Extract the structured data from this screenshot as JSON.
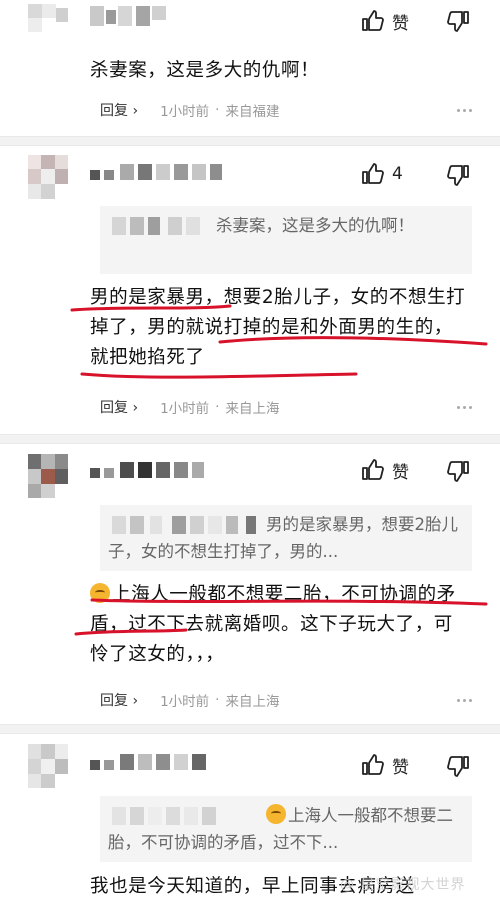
{
  "like_label": "赞",
  "reply_label": "回复",
  "comments": [
    {
      "likes": "赞",
      "text": "杀妻案，这是多大的仇啊！",
      "time": "1小时前",
      "location": "来自福建"
    },
    {
      "likes": "4",
      "quote_text": "杀妻案，这是多大的仇啊！",
      "text": "男的是家暴男，想要2胎儿子，女的不想生打掉了，男的就说打掉的是和外面男的生的，就把她掐死了",
      "time": "1小时前",
      "location": "来自上海"
    },
    {
      "likes": "赞",
      "quote_text": "男的是家暴男，想要2胎儿子，女的不想生打掉了，男的...",
      "text": "上海人一般都不想要二胎，不可协调的矛盾，过不下去就离婚呗。这下子玩大了，可怜了这女的，，，",
      "time": "1小时前",
      "location": "来自上海"
    },
    {
      "likes": "赞",
      "quote_text": "上海人一般都不想要二胎，不可协调的矛盾，过不下...",
      "text": "我也是今天知道的，早上同事去病房送"
    }
  ],
  "watermark": "@ 星空影视大世界",
  "colors": {
    "underline": "#d8122a",
    "muted": "#999999",
    "quote_bg": "#f4f4f4"
  },
  "icons": [
    "thumbs-up-icon",
    "thumbs-down-icon",
    "more-icon",
    "sad-emoji-icon"
  ]
}
